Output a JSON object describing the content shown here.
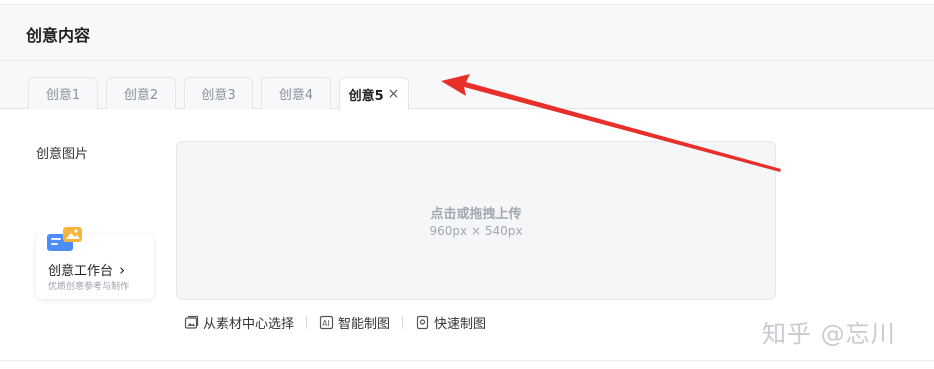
{
  "header": {
    "title": "创意内容"
  },
  "tabs": [
    {
      "label": "创意1"
    },
    {
      "label": "创意2"
    },
    {
      "label": "创意3"
    },
    {
      "label": "创意4"
    },
    {
      "label": "创意5",
      "active": true
    }
  ],
  "tab_close_glyph": "×",
  "form": {
    "image_label": "创意图片",
    "upload": {
      "main_text": "点击或拖拽上传",
      "size_hint": "960px × 540px"
    },
    "workbench": {
      "title": "创意工作台",
      "chevron": "›",
      "subtitle": "优质创意参考与制作"
    },
    "actions": [
      {
        "label": "从素材中心选择",
        "icon": "image-library-icon"
      },
      {
        "label": "智能制图",
        "icon": "ai-icon"
      },
      {
        "label": "快速制图",
        "icon": "template-icon"
      }
    ]
  },
  "watermark": "知乎 @忘川",
  "colors": {
    "accent_arrow": "#e8302a",
    "header_bg": "#f7f8fa",
    "upload_bg": "#f5f6f8"
  }
}
